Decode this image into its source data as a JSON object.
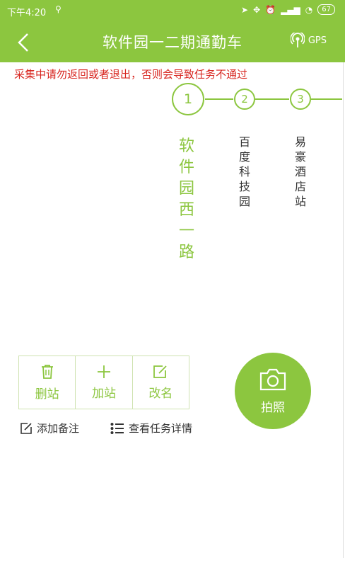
{
  "status_bar": {
    "time": "下午4:20",
    "battery": "67"
  },
  "header": {
    "title": "软件园一二期通勤车",
    "gps_label": "GPS"
  },
  "warning": "采集中请勿返回或者退出，否则会导致任务不通过",
  "steps": [
    {
      "number": "1",
      "name": "软件园西一路"
    },
    {
      "number": "2",
      "name": "百度科技园"
    },
    {
      "number": "3",
      "name": "易豪酒店站"
    }
  ],
  "tools": {
    "delete": "删站",
    "add": "加站",
    "rename": "改名"
  },
  "photo_button": "拍照",
  "links": {
    "add_note": "添加备注",
    "view_task": "查看任务详情"
  },
  "colors": {
    "primary": "#8cc63f",
    "warning": "#d8251f"
  }
}
